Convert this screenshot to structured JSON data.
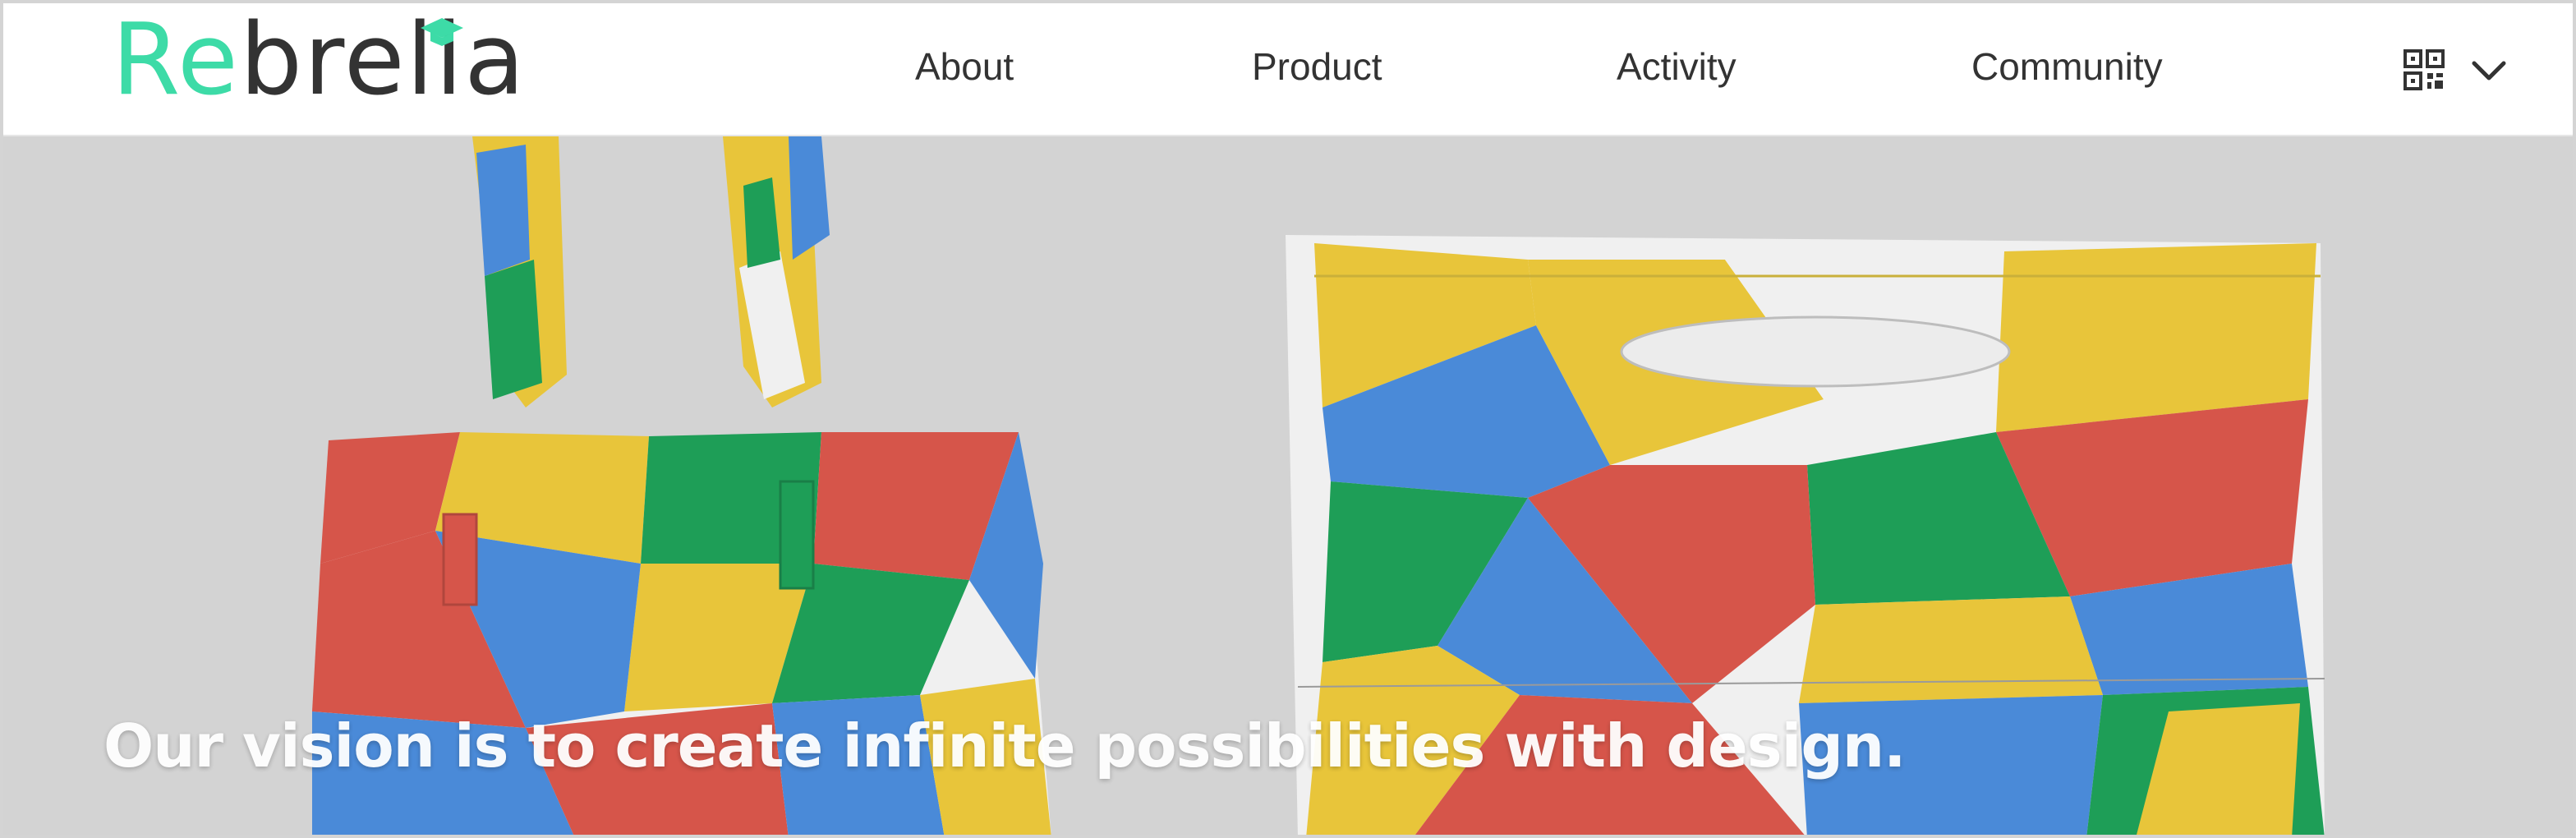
{
  "brand": {
    "logo_part1": "Re",
    "logo_part2": "brella",
    "logo_accent_color": "#3ddba7",
    "logo_text_color": "#333333"
  },
  "nav": {
    "items": [
      {
        "label": "About"
      },
      {
        "label": "Product"
      },
      {
        "label": "Activity"
      },
      {
        "label": "Community"
      }
    ],
    "qr_icon": "qr-code-icon",
    "dropdown_icon": "chevron-down-icon"
  },
  "hero": {
    "tagline": "Our vision is to create infinite possibilities with design.",
    "background_color": "#d3d3d3",
    "pattern_colors": [
      "#e8c53a",
      "#4a8ad8",
      "#d6554a",
      "#1e9e57",
      "#f0f0f0"
    ]
  }
}
